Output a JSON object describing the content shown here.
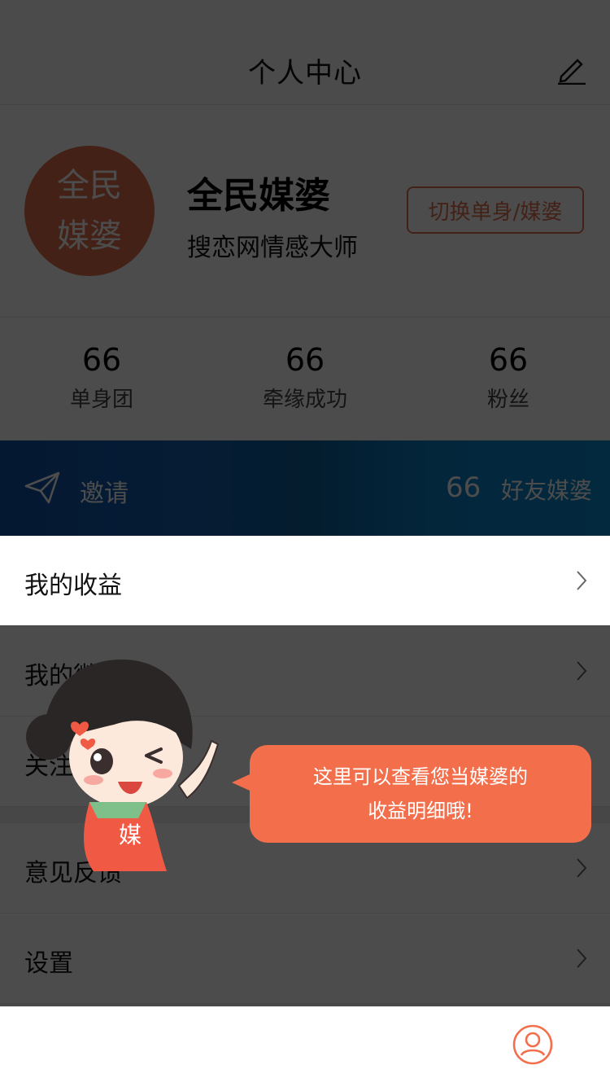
{
  "header": {
    "title": "个人中心"
  },
  "profile": {
    "avatar_line1": "全民",
    "avatar_line2": "媒婆",
    "name": "全民媒婆",
    "subtitle": "搜恋网情感大师",
    "switch_label": "切换单身/媒婆"
  },
  "stats": [
    {
      "num": "66",
      "label": "单身团"
    },
    {
      "num": "66",
      "label": "牵缘成功"
    },
    {
      "num": "66",
      "label": "粉丝"
    }
  ],
  "banner": {
    "invite_label": "邀请",
    "count": "66",
    "friend_label": "好友媒婆"
  },
  "menu": [
    {
      "label": "我的收益"
    },
    {
      "label": "我的微信号"
    },
    {
      "label": "关注"
    },
    {
      "label": "意见反馈"
    },
    {
      "label": "设置"
    }
  ],
  "guide": {
    "line1": "这里可以查看您当媒婆的",
    "line2": "收益明细哦!",
    "mascot_badge": "媒"
  },
  "colors": {
    "accent": "#e0704f",
    "bubble": "#f36f4c",
    "banner_blue": "#1350a8"
  }
}
